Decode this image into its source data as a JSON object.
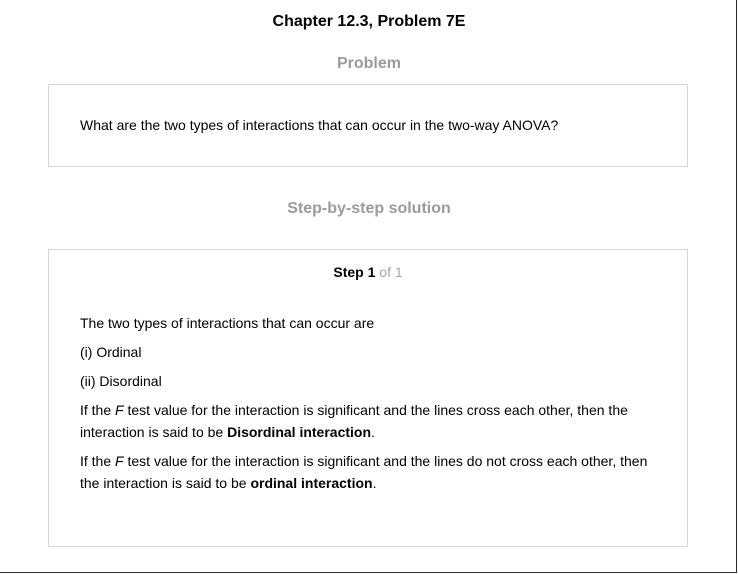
{
  "header": {
    "title": "Chapter 12.3, Problem 7E"
  },
  "problem": {
    "heading": "Problem",
    "text": "What are the two types of interactions that can occur in the two-way ANOVA?"
  },
  "solution": {
    "heading": "Step-by-step solution",
    "step_word": "Step",
    "step_number": "1",
    "step_of": "of 1",
    "intro": "The two types of interactions that can occur are",
    "item_1": "(i) Ordinal",
    "item_2": "(ii) Disordinal",
    "para1": {
      "pre": "If the ",
      "italic": "F",
      "mid": " test value for the interaction is significant and the lines cross each other, then the interaction is said to be ",
      "bold": "Disordinal interaction",
      "post": "."
    },
    "para2": {
      "pre": "If the ",
      "italic": "F",
      "mid": " test value for the interaction is significant and the lines do not cross each other, then the interaction is said to be ",
      "bold": "ordinal interaction",
      "post": "."
    }
  }
}
